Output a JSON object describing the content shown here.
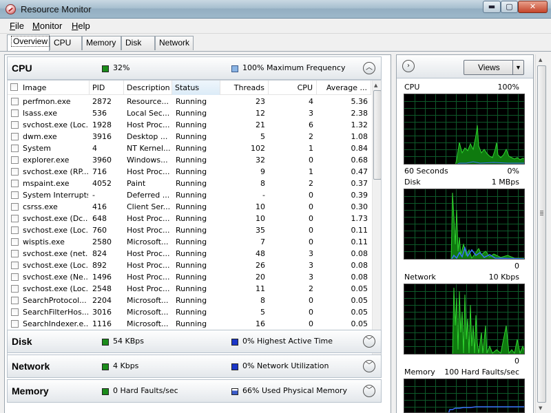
{
  "window": {
    "title": "Resource Monitor",
    "min_glyph": "▬",
    "max_glyph": "▢",
    "close_glyph": "✕"
  },
  "menu": [
    "File",
    "Monitor",
    "Help"
  ],
  "tabs": [
    "Overview",
    "CPU",
    "Memory",
    "Disk",
    "Network"
  ],
  "active_tab": "Overview",
  "sections": {
    "cpu": {
      "title": "CPU",
      "stat1": "32%",
      "stat2": "100% Maximum Frequency",
      "expanded": true,
      "toggle_glyph": "︿"
    },
    "disk": {
      "title": "Disk",
      "stat1": "54 KBps",
      "stat2": "0% Highest Active Time",
      "toggle_glyph": "﹀"
    },
    "network": {
      "title": "Network",
      "stat1": "4 Kbps",
      "stat2": "0% Network Utilization",
      "toggle_glyph": "﹀"
    },
    "memory": {
      "title": "Memory",
      "stat1": "0 Hard Faults/sec",
      "stat2": "66% Used Physical Memory",
      "toggle_glyph": "﹀"
    }
  },
  "table": {
    "columns": [
      "Image",
      "PID",
      "Description",
      "Status",
      "Threads",
      "CPU",
      "Average ..."
    ],
    "sorted_column": "Status",
    "rows": [
      [
        "perfmon.exe",
        "2872",
        "Resource...",
        "Running",
        "23",
        "4",
        "5.36"
      ],
      [
        "lsass.exe",
        "536",
        "Local Sec...",
        "Running",
        "12",
        "3",
        "2.38"
      ],
      [
        "svchost.exe (Loc...",
        "1928",
        "Host Proc...",
        "Running",
        "21",
        "6",
        "1.32"
      ],
      [
        "dwm.exe",
        "3916",
        "Desktop ...",
        "Running",
        "5",
        "2",
        "1.08"
      ],
      [
        "System",
        "4",
        "NT Kernel...",
        "Running",
        "102",
        "1",
        "0.84"
      ],
      [
        "explorer.exe",
        "3960",
        "Windows...",
        "Running",
        "32",
        "0",
        "0.68"
      ],
      [
        "svchost.exe (RP...",
        "716",
        "Host Proc...",
        "Running",
        "9",
        "1",
        "0.47"
      ],
      [
        "mspaint.exe",
        "4052",
        "Paint",
        "Running",
        "8",
        "2",
        "0.37"
      ],
      [
        "System Interrupts",
        "-",
        "Deferred ...",
        "Running",
        "-",
        "0",
        "0.39"
      ],
      [
        "csrss.exe",
        "416",
        "Client Ser...",
        "Running",
        "10",
        "0",
        "0.30"
      ],
      [
        "svchost.exe (Dc...",
        "648",
        "Host Proc...",
        "Running",
        "10",
        "0",
        "1.73"
      ],
      [
        "svchost.exe (Loc...",
        "760",
        "Host Proc...",
        "Running",
        "35",
        "0",
        "0.11"
      ],
      [
        "wisptis.exe",
        "2580",
        "Microsoft...",
        "Running",
        "7",
        "0",
        "0.11"
      ],
      [
        "svchost.exe (net...",
        "824",
        "Host Proc...",
        "Running",
        "48",
        "3",
        "0.08"
      ],
      [
        "svchost.exe (Loc...",
        "892",
        "Host Proc...",
        "Running",
        "26",
        "3",
        "0.08"
      ],
      [
        "svchost.exe (Ne...",
        "1496",
        "Host Proc...",
        "Running",
        "20",
        "3",
        "0.08"
      ],
      [
        "svchost.exe (Loc...",
        "2548",
        "Host Proc...",
        "Running",
        "11",
        "2",
        "0.05"
      ],
      [
        "SearchProtocol...",
        "2204",
        "Microsoft...",
        "Running",
        "8",
        "0",
        "0.05"
      ],
      [
        "SearchFilterHos...",
        "3016",
        "Microsoft...",
        "Running",
        "5",
        "0",
        "0.05"
      ],
      [
        "SearchIndexer.e...",
        "1116",
        "Microsoft...",
        "Running",
        "16",
        "0",
        "0.05"
      ]
    ]
  },
  "right_pane": {
    "nav_glyph": "›",
    "views_label": "Views",
    "views_drop_glyph": "▼",
    "graphs": {
      "cpu": {
        "title": "CPU",
        "top_value": "100%",
        "bottom_left": "60 Seconds",
        "bottom_right": "0%"
      },
      "disk": {
        "title": "Disk",
        "top_value": "1 MBps",
        "bottom_right": "0"
      },
      "network": {
        "title": "Network",
        "top_value": "10 Kbps",
        "bottom_right": "0"
      },
      "memory": {
        "title": "Memory",
        "top_value": "100 Hard Faults/sec"
      }
    }
  },
  "colors": {
    "graph_green": "#2fd42f",
    "graph_fill": "#0f7a0f",
    "graph_grid": "#0e5a2a",
    "graph_blue": "#3a70ff"
  }
}
